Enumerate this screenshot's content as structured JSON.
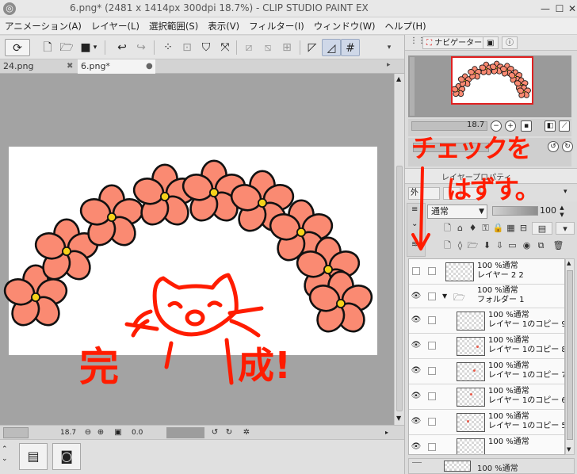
{
  "window": {
    "title": "6.png* (2481 x 1414px 300dpi 18.7%) - CLIP STUDIO PAINT EX",
    "icon": "clip-studio-icon",
    "controls": [
      "minimize",
      "maximize",
      "close"
    ]
  },
  "menu": [
    "アニメーション(A)",
    "レイヤー(L)",
    "選択範囲(S)",
    "表示(V)",
    "フィルター(I)",
    "ウィンドウ(W)",
    "ヘルプ(H)"
  ],
  "toolbar": {
    "icons": [
      "clip-studio-logo-icon",
      "new-file-icon",
      "open-file-icon",
      "save-icon",
      "undo-icon",
      "redo-icon",
      "clear-selection-icon",
      "crop-icon",
      "fill-icon",
      "transform-icon",
      "snap-ruler-icon",
      "snap-grid-icon",
      "snap-special-ruler-icon",
      "ruler-icon",
      "guide-icon",
      "grid-icon"
    ]
  },
  "tabs": [
    {
      "label": "24.png",
      "close": "✖",
      "active": false
    },
    {
      "label": "6.png*",
      "close": "●",
      "active": true
    }
  ],
  "canvas_status": {
    "zoom": "18.7",
    "angle": "0.0"
  },
  "navigator": {
    "tab_label": "ナビゲーター",
    "zoom": "18.7"
  },
  "layer_panel": {
    "tab_label": "レイヤープロパティ",
    "blend_mode": "通常",
    "opacity": "100",
    "layers": [
      {
        "percent": "100 %通常",
        "name": "レイヤー 2 2",
        "visible": false,
        "type": "layer",
        "indent": 0
      },
      {
        "percent": "100 %通常",
        "name": "フォルダー 1",
        "visible": true,
        "type": "folder",
        "indent": 0
      },
      {
        "percent": "100 %通常",
        "name": "レイヤー 1のコピー 9",
        "visible": true,
        "type": "layer",
        "indent": 1
      },
      {
        "percent": "100 %通常",
        "name": "レイヤー 1のコピー 8",
        "visible": true,
        "type": "layer",
        "indent": 1
      },
      {
        "percent": "100 %通常",
        "name": "レイヤー 1のコピー 7",
        "visible": true,
        "type": "layer",
        "indent": 1
      },
      {
        "percent": "100 %通常",
        "name": "レイヤー 1のコピー 6",
        "visible": true,
        "type": "layer",
        "indent": 1
      },
      {
        "percent": "100 %通常",
        "name": "レイヤー 1のコピー 5",
        "visible": true,
        "type": "layer",
        "indent": 1
      },
      {
        "percent": "100 %通常",
        "name": "",
        "visible": true,
        "type": "layer",
        "indent": 1
      }
    ],
    "bottom_row_percent": "100 %通常"
  },
  "annotations": {
    "check_off_line1": "チェックを",
    "check_off_line2": "はずす。",
    "canvas_text_1": "完",
    "canvas_text_2": "成!"
  },
  "colors": {
    "flower_fill": "#fa8a72",
    "flower_center": "#f6d21a",
    "annotation_red": "#ff1c00",
    "canvas_gray": "#a3a3a3"
  }
}
